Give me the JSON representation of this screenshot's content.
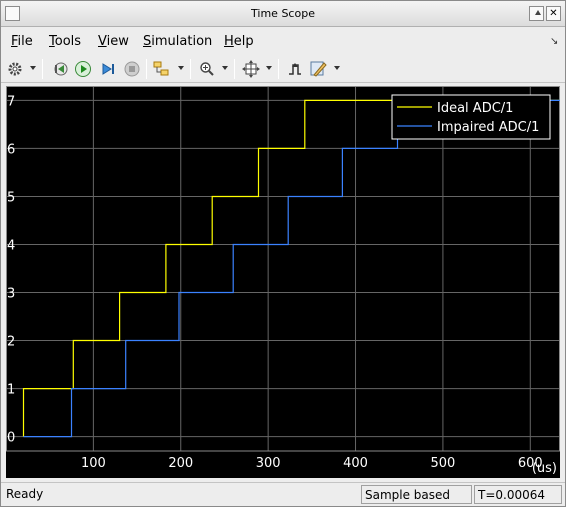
{
  "window": {
    "title": "Time Scope"
  },
  "menu": [
    {
      "accel": "F",
      "rest": "ile"
    },
    {
      "accel": "T",
      "rest": "ools"
    },
    {
      "accel": "V",
      "rest": "iew"
    },
    {
      "accel": "S",
      "rest": "imulation"
    },
    {
      "accel": "H",
      "rest": "elp"
    }
  ],
  "toolbar": {
    "icons": [
      "gear-icon",
      "step-back-icon",
      "run-icon",
      "step-forward-icon",
      "stop-icon",
      "highlight-block-icon",
      "zoom-in-icon",
      "fit-view-icon",
      "triggers-icon",
      "style-icon"
    ]
  },
  "colors": {
    "ideal": "#ffff00",
    "impaired": "#3b82ff",
    "grid": "#666666",
    "tick_text": "#ffffff"
  },
  "chart_data": {
    "type": "line",
    "xlabel": "(us)",
    "xlim": [
      0,
      634
    ],
    "ylim": [
      -0.3,
      7.3
    ],
    "xticks": [
      100,
      200,
      300,
      400,
      500,
      600
    ],
    "yticks": [
      0,
      1,
      2,
      3,
      4,
      5,
      6,
      7
    ],
    "grid": true,
    "legend_position": "top-right",
    "series": [
      {
        "name": "Ideal ADC/1",
        "color": "#ffff00",
        "step": true,
        "points": [
          [
            20,
            0
          ],
          [
            20,
            1
          ],
          [
            77,
            1
          ],
          [
            77,
            2
          ],
          [
            130,
            2
          ],
          [
            130,
            3
          ],
          [
            183,
            3
          ],
          [
            183,
            4
          ],
          [
            236,
            4
          ],
          [
            236,
            5
          ],
          [
            289,
            5
          ],
          [
            289,
            6
          ],
          [
            342,
            6
          ],
          [
            342,
            7
          ],
          [
            634,
            7
          ]
        ]
      },
      {
        "name": "Impaired ADC/1",
        "color": "#3b82ff",
        "step": true,
        "points": [
          [
            20,
            0
          ],
          [
            75,
            0
          ],
          [
            75,
            1
          ],
          [
            137,
            1
          ],
          [
            137,
            2
          ],
          [
            198,
            2
          ],
          [
            198,
            3
          ],
          [
            260,
            3
          ],
          [
            260,
            4
          ],
          [
            323,
            4
          ],
          [
            323,
            5
          ],
          [
            385,
            5
          ],
          [
            385,
            6
          ],
          [
            448,
            6
          ],
          [
            448,
            7
          ],
          [
            634,
            7
          ]
        ]
      }
    ]
  },
  "status": {
    "state": "Ready",
    "mode": "Sample based",
    "time": "T=0.00064"
  }
}
